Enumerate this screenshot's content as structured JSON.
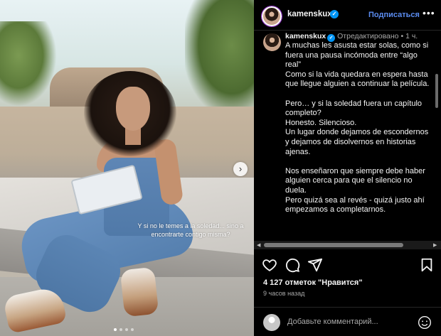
{
  "photo": {
    "overlay_caption": "Y si no le temes a la soledad... sino a encontrarte contigo misma?",
    "next_icon": "chevron-right-icon",
    "carousel_dots": 4,
    "carousel_active": 0
  },
  "header": {
    "username": "kamenskux",
    "verified_icon": "verified-badge-icon",
    "follow_label": "Подписаться",
    "more_icon": "more-horizontal-icon",
    "accent": "#5b8cf0"
  },
  "caption": {
    "username": "kamenskux",
    "edited": "Отредактировано",
    "separator": "•",
    "time": "1 ч.",
    "lines": [
      "A muchas les asusta estar solas, como si fuera una pausa incómoda entre “algo real”",
      "Como si la vida quedara en espera hasta que llegue alguien a continuar la película.",
      "",
      "Pero… y si la soledad fuera un capítulo completo?",
      "Honesto. Silencioso.",
      "Un lugar donde dejamos de escondernos y dejamos de disolvernos en historias ajenas.",
      "",
      "Nos enseñaron que siempre debe haber alguien cerca para que el silencio no duela.",
      "Pero quizá sea al revés - quizá justo ahí empezamos a completarnos."
    ]
  },
  "actions": {
    "like_icon": "heart-icon",
    "comment_icon": "comment-icon",
    "share_icon": "share-icon",
    "save_icon": "bookmark-icon"
  },
  "likes_text": "4 127 отметок \"Нравится\"",
  "timestamp": "9 часов назад",
  "add_comment": {
    "placeholder": "Добавьте комментарий...",
    "emoji_icon": "emoji-icon"
  }
}
